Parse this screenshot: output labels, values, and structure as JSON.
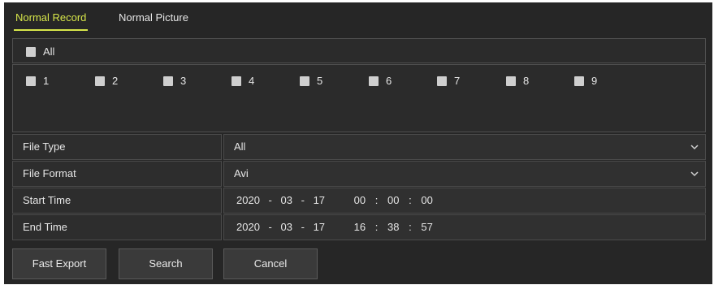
{
  "tabs": [
    {
      "label": "Normal Record",
      "active": true
    },
    {
      "label": "Normal Picture",
      "active": false
    }
  ],
  "channels": {
    "all_label": "All",
    "items": [
      "1",
      "2",
      "3",
      "4",
      "5",
      "6",
      "7",
      "8",
      "9"
    ]
  },
  "fields": {
    "file_type": {
      "label": "File Type",
      "value": "All"
    },
    "file_format": {
      "label": "File Format",
      "value": "Avi"
    },
    "start_time": {
      "label": "Start Time",
      "year": "2020",
      "month": "03",
      "day": "17",
      "hour": "00",
      "minute": "00",
      "second": "00"
    },
    "end_time": {
      "label": "End Time",
      "year": "2020",
      "month": "03",
      "day": "17",
      "hour": "16",
      "minute": "38",
      "second": "57"
    }
  },
  "buttons": {
    "fast_export": "Fast Export",
    "search": "Search",
    "cancel": "Cancel"
  },
  "colors": {
    "accent": "#d7e64a",
    "background": "#262626"
  }
}
